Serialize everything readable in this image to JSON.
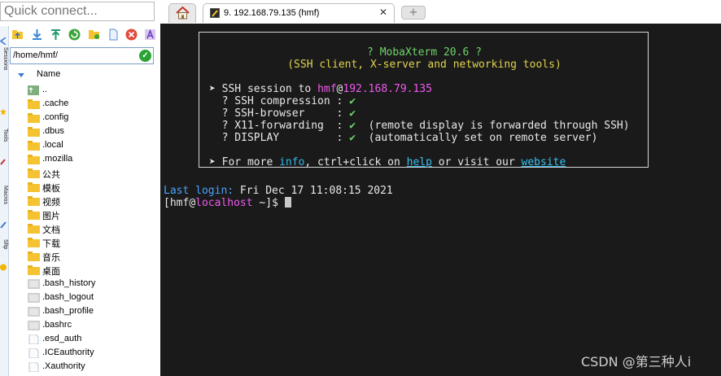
{
  "quick_connect": {
    "placeholder": "Quick connect..."
  },
  "side_tabs": [
    {
      "label": "Sessions"
    },
    {
      "label": "Tools"
    },
    {
      "label": "Macros"
    },
    {
      "label": "Sftp"
    }
  ],
  "file_browser": {
    "path": "/home/hmf/",
    "column_header": "Name",
    "items": [
      {
        "name": "..",
        "type": "parent"
      },
      {
        "name": ".cache",
        "type": "folder"
      },
      {
        "name": ".config",
        "type": "folder"
      },
      {
        "name": ".dbus",
        "type": "folder"
      },
      {
        "name": ".local",
        "type": "folder"
      },
      {
        "name": ".mozilla",
        "type": "folder"
      },
      {
        "name": "公共",
        "type": "folder"
      },
      {
        "name": "模板",
        "type": "folder"
      },
      {
        "name": "视频",
        "type": "folder"
      },
      {
        "name": "图片",
        "type": "folder"
      },
      {
        "name": "文档",
        "type": "folder"
      },
      {
        "name": "下载",
        "type": "folder"
      },
      {
        "name": "音乐",
        "type": "folder"
      },
      {
        "name": "桌面",
        "type": "folder"
      },
      {
        "name": ".bash_history",
        "type": "file"
      },
      {
        "name": ".bash_logout",
        "type": "file"
      },
      {
        "name": ".bash_profile",
        "type": "file"
      },
      {
        "name": ".bashrc",
        "type": "file"
      },
      {
        "name": ".esd_auth",
        "type": "doc"
      },
      {
        "name": ".ICEauthority",
        "type": "doc"
      },
      {
        "name": ".Xauthority",
        "type": "doc"
      }
    ]
  },
  "tabs": {
    "session_label": "9. 192.168.79.135 (hmf)",
    "close_glyph": "✕",
    "new_tab_glyph": "+"
  },
  "terminal": {
    "banner_title": "? MobaXterm 20.6 ?",
    "banner_subtitle": "(SSH client, X-server and networking tools)",
    "session_prefix": "➤ SSH session to ",
    "session_user": "hmf",
    "session_at": "@",
    "session_host": "192.168.79.135",
    "check_glyph": "✔",
    "ssh_compression_label": "  ? SSH compression : ",
    "ssh_browser_label": "  ? SSH-browser     : ",
    "x11_label": "  ? X11-forwarding  : ",
    "x11_note": "  (remote display is forwarded through SSH)",
    "display_label": "  ? DISPLAY         : ",
    "display_note": "  (automatically set on remote server)",
    "more_info_prefix": "➤ For more ",
    "more_info_word": "info",
    "more_info_mid": ", ctrl+click on ",
    "help_link": "help",
    "visit_text": " or visit our ",
    "website_link": "website",
    "last_login_label": "Last login:",
    "last_login_value": " Fri Dec 17 11:08:15 2021",
    "prompt_open": "[",
    "prompt_user": "hmf",
    "prompt_at": "@",
    "prompt_host": "localhost",
    "prompt_close": " ~]$ "
  },
  "watermark": "CSDN @第三种人i",
  "colors": {
    "terminal_bg": "#1a1a1a",
    "banner_green": "#6fd36b",
    "banner_yellow": "#e0d34b",
    "user_magenta": "#f05af0",
    "host_blue": "#4aa3ff",
    "link_cyan": "#39c0f0",
    "folder_yellow": "#f5c331"
  }
}
